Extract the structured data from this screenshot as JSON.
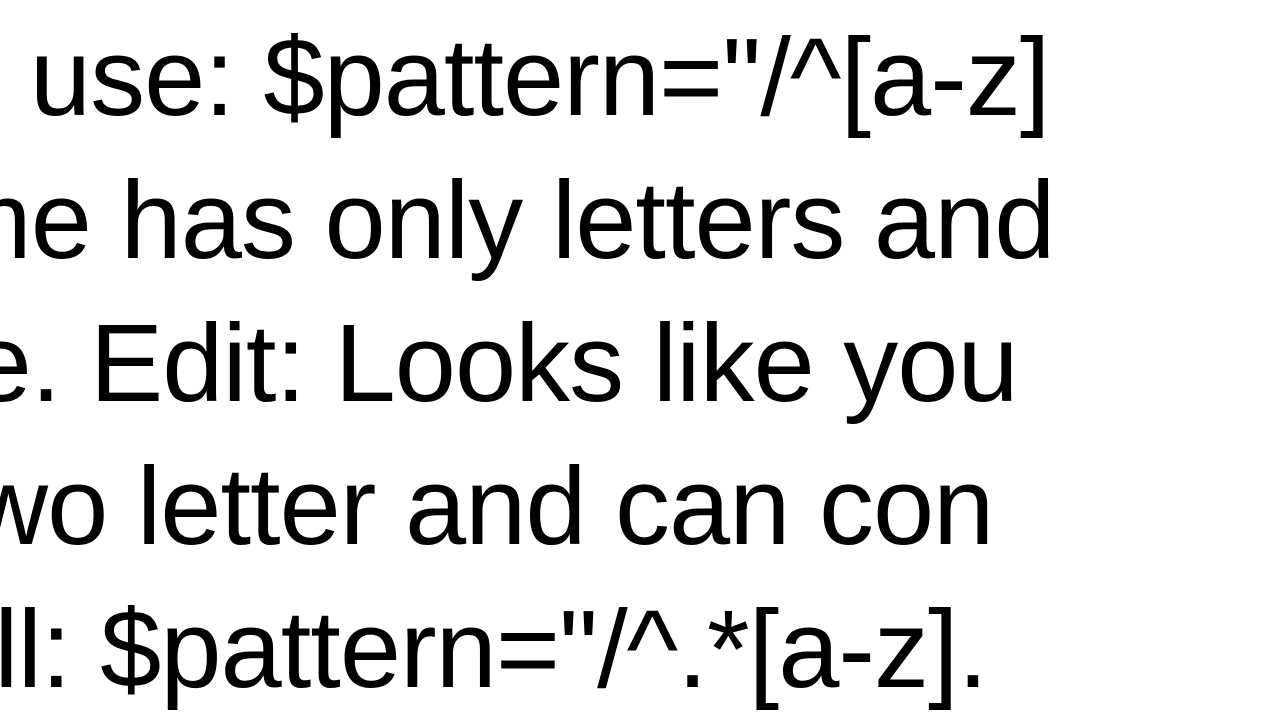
{
  "lines": {
    "l1": "an use: $pattern=\"/^[a-z]",
    "l2": "ame has only letters and",
    "l3": "me. Edit: Looks like you",
    "l4": "t two letter and can con",
    "l5": "vell: $pattern=\"/^.*[a-z]."
  }
}
